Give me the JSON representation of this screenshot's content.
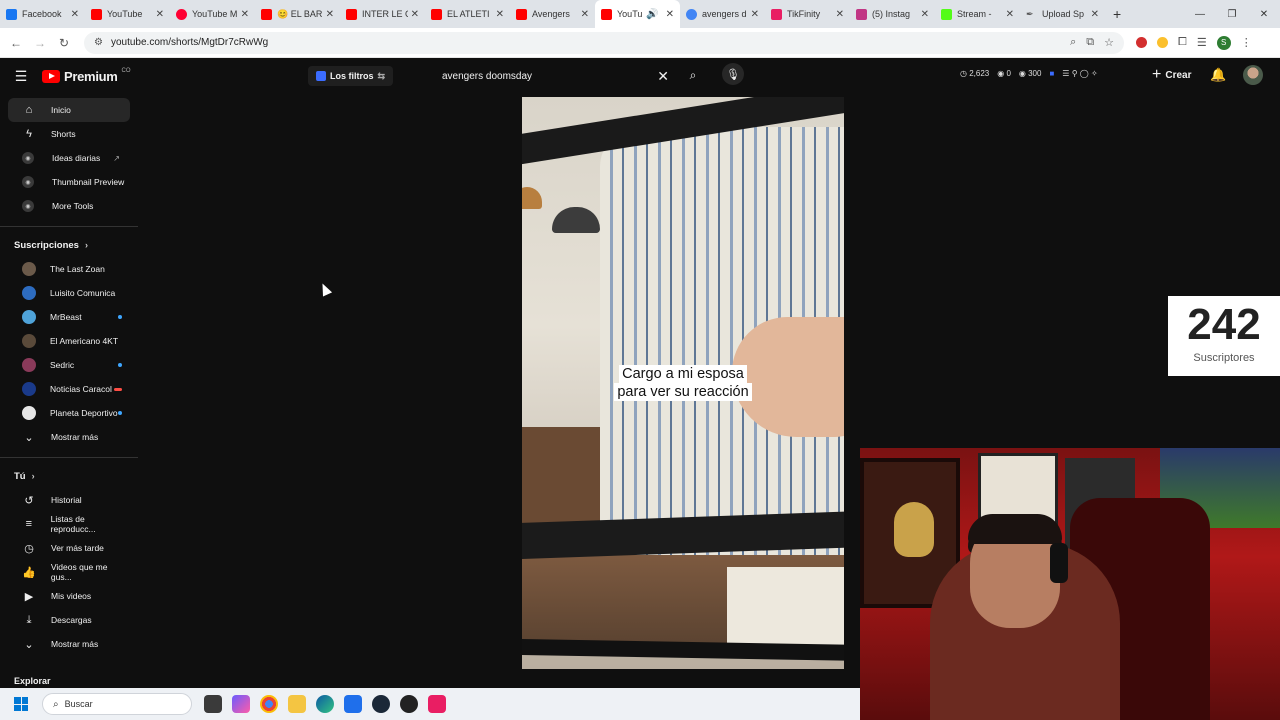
{
  "browser": {
    "tabs": [
      {
        "title": "Facebook",
        "color": "#1877f2",
        "active": false
      },
      {
        "title": "YouTube",
        "color": "#ff0000",
        "active": false
      },
      {
        "title": "YouTube M",
        "color": "#ff0033",
        "active": false
      },
      {
        "title": "😊 EL BAR",
        "color": "#ff0000",
        "active": false
      },
      {
        "title": "INTER LE C",
        "color": "#ff0000",
        "active": false
      },
      {
        "title": "EL ATLETI",
        "color": "#ff0000",
        "active": false
      },
      {
        "title": "Avengers",
        "color": "#ff0000",
        "active": false
      },
      {
        "title": "YouTu",
        "color": "#ff0000",
        "active": true
      },
      {
        "title": "avengers d",
        "color": "#4285f4",
        "active": false
      },
      {
        "title": "TikFinity",
        "color": "#e91e63",
        "active": false
      },
      {
        "title": "(5) Instag",
        "color": "#c13584",
        "active": false
      },
      {
        "title": "Stream -",
        "color": "#53fc18",
        "active": false
      },
      {
        "title": "Upload Sp",
        "color": "#555555",
        "active": false
      }
    ],
    "url": "youtube.com/shorts/MgtDr7cRwWg"
  },
  "header": {
    "brand": "Premium",
    "country": "CO",
    "filters_label": "Los filtros",
    "search_value": "avengers doomsday",
    "stats": [
      "2,623",
      "0",
      "300"
    ],
    "create_label": "Crear"
  },
  "sidebar": {
    "main": [
      {
        "label": "Inicio",
        "icon": "home-icon"
      },
      {
        "label": "Shorts",
        "icon": "shorts-icon"
      },
      {
        "label": "Ideas diarias",
        "icon": "ideas-icon"
      },
      {
        "label": "Thumbnail Preview",
        "icon": "thumbnail-icon"
      },
      {
        "label": "More Tools",
        "icon": "tools-icon"
      }
    ],
    "subs_title": "Suscripciones",
    "subs": [
      {
        "label": "The Last Zoan",
        "color": "#6b5a4a"
      },
      {
        "label": "Luisito Comunica",
        "color": "#2d6cc0"
      },
      {
        "label": "MrBeast",
        "color": "#4fa3d9"
      },
      {
        "label": "El Americano 4KT",
        "color": "#5a4a3a"
      },
      {
        "label": "Sedric",
        "color": "#8a3a5a"
      },
      {
        "label": "Noticias Caracol",
        "color": "#1a3a8a"
      },
      {
        "label": "Planeta Deportivo",
        "color": "#e6e6e6"
      }
    ],
    "more_label": "Mostrar más",
    "you_title": "Tú",
    "you": [
      {
        "label": "Historial",
        "icon": "history-icon"
      },
      {
        "label": "Listas de reproducc...",
        "icon": "playlists-icon"
      },
      {
        "label": "Ver más tarde",
        "icon": "watch-later-icon"
      },
      {
        "label": "Videos que me gus...",
        "icon": "liked-icon"
      },
      {
        "label": "Mis videos",
        "icon": "my-videos-icon"
      },
      {
        "label": "Descargas",
        "icon": "downloads-icon"
      }
    ],
    "more_label_2": "Mostrar más",
    "explore_title": "Explorar"
  },
  "video": {
    "caption_line1": "Cargo a mi esposa",
    "caption_line2": "para ver su reacción"
  },
  "subs_widget": {
    "count": "242",
    "label": "Suscriptores"
  },
  "taskbar": {
    "search_placeholder": "Buscar"
  }
}
